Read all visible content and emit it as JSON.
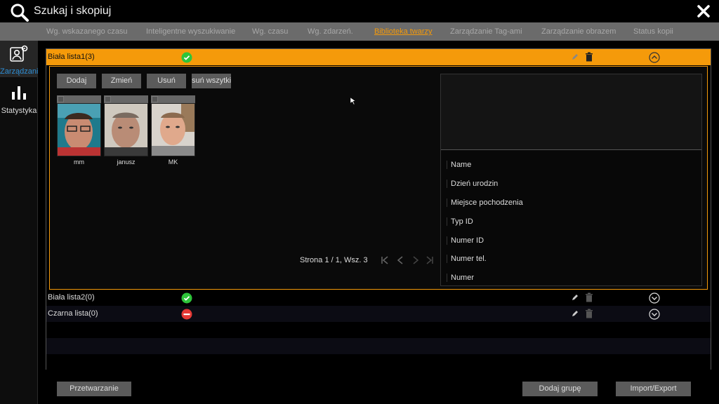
{
  "window": {
    "title": "Szukaj i skopiuj"
  },
  "tabs": [
    {
      "label": "Wg. wskazanego czasu"
    },
    {
      "label": "Inteligentne wyszukiwanie"
    },
    {
      "label": "Wg. czasu"
    },
    {
      "label": "Wg. zdarzeń."
    },
    {
      "label": "Biblioteka twarzy",
      "active": true
    },
    {
      "label": "Zarządzanie Tag-ami"
    },
    {
      "label": "Zarządzanie obrazem"
    },
    {
      "label": "Status kopii"
    }
  ],
  "sidebar": [
    {
      "label": "Zarządzanie",
      "icon": "person-gear-icon",
      "active": true
    },
    {
      "label": "Statystyka",
      "icon": "bar-chart-icon"
    }
  ],
  "groups": [
    {
      "name": "Biała lista1(3)",
      "status": "allowed",
      "expanded": true
    },
    {
      "name": "Biała lista2(0)",
      "status": "allowed",
      "expanded": false
    },
    {
      "name": "Czarna lista(0)",
      "status": "blocked",
      "expanded": false
    }
  ],
  "actions": {
    "add": "Dodaj",
    "edit": "Zmień",
    "delete": "Usuń",
    "delete_all": "suń wszytki"
  },
  "faces": [
    {
      "name": "mm"
    },
    {
      "name": "janusz"
    },
    {
      "name": "MK"
    }
  ],
  "pager": {
    "text": "Strona 1 / 1, Wsz. 3"
  },
  "info_fields": [
    "Name",
    "Dzień urodzin",
    "Miejsce pochodzenia",
    "Typ ID",
    "Numer ID",
    "Numer tel.",
    "Numer"
  ],
  "footer": {
    "process": "Przetwarzanie",
    "add_group": "Dodaj grupę",
    "import_export": "Import/Export"
  },
  "colors": {
    "accent": "#f59a0a",
    "ok": "#2ec43a",
    "blocked": "#e53935",
    "active_blue": "#2e8fd6"
  }
}
